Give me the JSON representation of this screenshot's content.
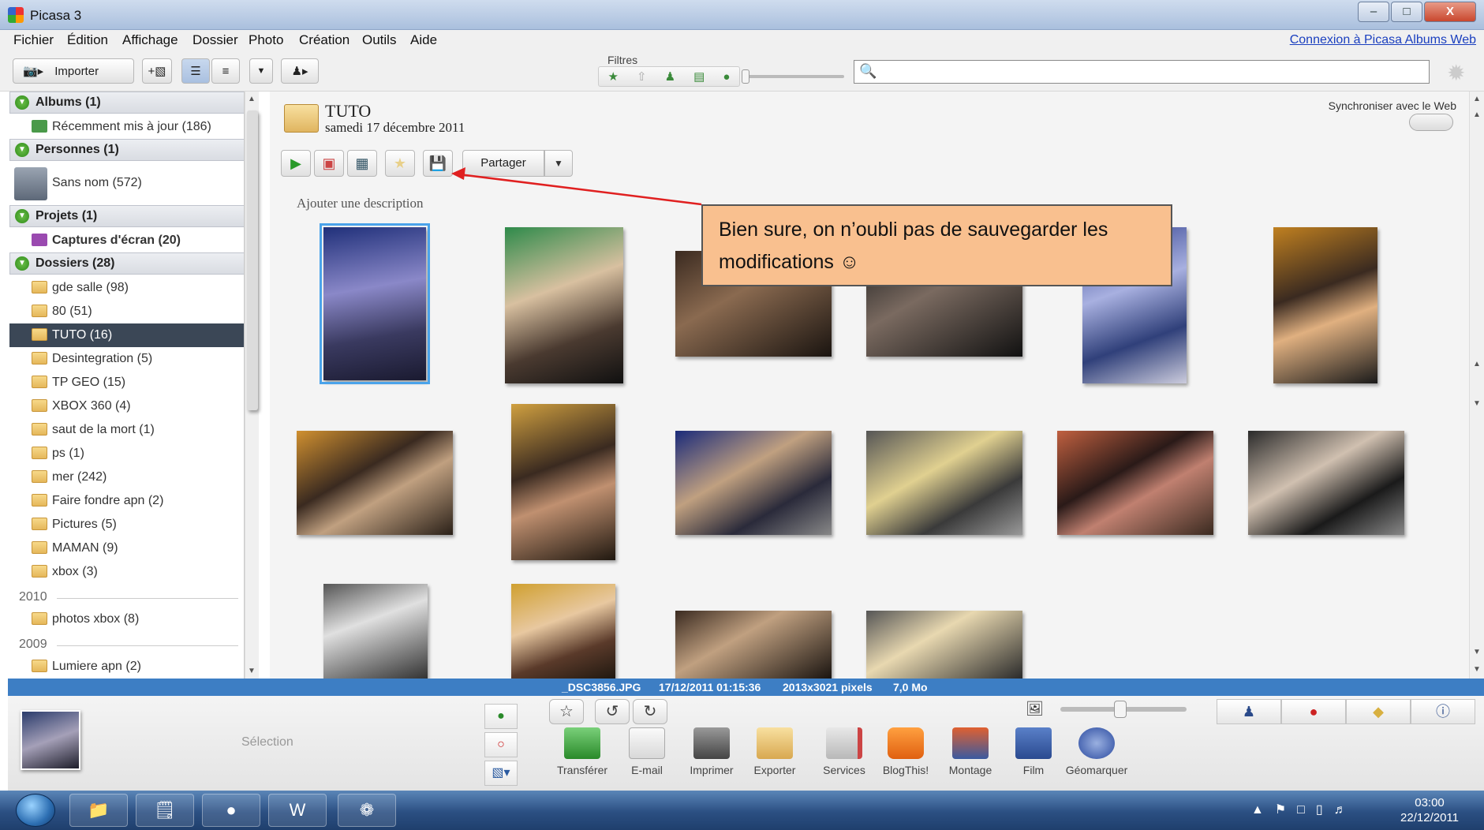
{
  "window": {
    "title": "Picasa 3",
    "controls": [
      "–",
      "□",
      "X"
    ]
  },
  "menu": {
    "items": [
      "Fichier",
      "Édition",
      "Affichage",
      "Dossier",
      "Photo",
      "Création",
      "Outils",
      "Aide"
    ],
    "login_link": "Connexion à Picasa Albums Web"
  },
  "toolbar": {
    "import_label": "Importer",
    "filters_label": "Filtres",
    "search_value": ""
  },
  "sidebar": {
    "albums_header": "Albums (1)",
    "albums_items": [
      "Récemment mis à jour (186)"
    ],
    "people_header": "Personnes (1)",
    "people_items": [
      "Sans nom (572)"
    ],
    "projects_header": "Projets (1)",
    "projects_items": [
      "Captures d'écran (20)"
    ],
    "folders_header": "Dossiers (28)",
    "folders": [
      "gde salle (98)",
      "80 (51)",
      "TUTO (16)",
      "Desintegration (5)",
      "TP GEO (15)",
      "XBOX 360 (4)",
      "saut de la mort (1)",
      "ps (1)",
      "mer (242)",
      "Faire fondre apn (2)",
      "Pictures (5)",
      "MAMAN (9)",
      "xbox (3)"
    ],
    "selected_folder": "TUTO (16)",
    "year_2010": "2010",
    "folders_2010": [
      "photos xbox (8)"
    ],
    "year_2009": "2009",
    "folders_2009": [
      "Lumiere apn (2)"
    ]
  },
  "album": {
    "title": "TUTO",
    "date": "samedi 17 décembre 2011",
    "sync_label": "Synchroniser avec le Web",
    "share_label": "Partager",
    "description_placeholder": "Ajouter une description"
  },
  "callout": {
    "line1": "Bien sure, on n’oubli pas de sauvegarder les",
    "line2": "modifications ☺"
  },
  "status": {
    "filename": "_DSC3856.JPG",
    "datetime": "17/12/2011 01:15:36",
    "dimensions": "2013x3021 pixels",
    "size": "7,0 Mo"
  },
  "tray": {
    "selection_label": "Sélection",
    "actions": [
      "Transférer",
      "E-mail",
      "Imprimer",
      "Exporter",
      "Services",
      "BlogThis!",
      "Montage",
      "Film",
      "Géomarquer"
    ]
  },
  "taskbar": {
    "time": "03:00",
    "date": "22/12/2011"
  },
  "colors": {
    "accent": "#3d7ec4",
    "selected_sidebar": "#3b4756",
    "callout_fill": "#f9c08f",
    "arrow": "#e02020"
  }
}
